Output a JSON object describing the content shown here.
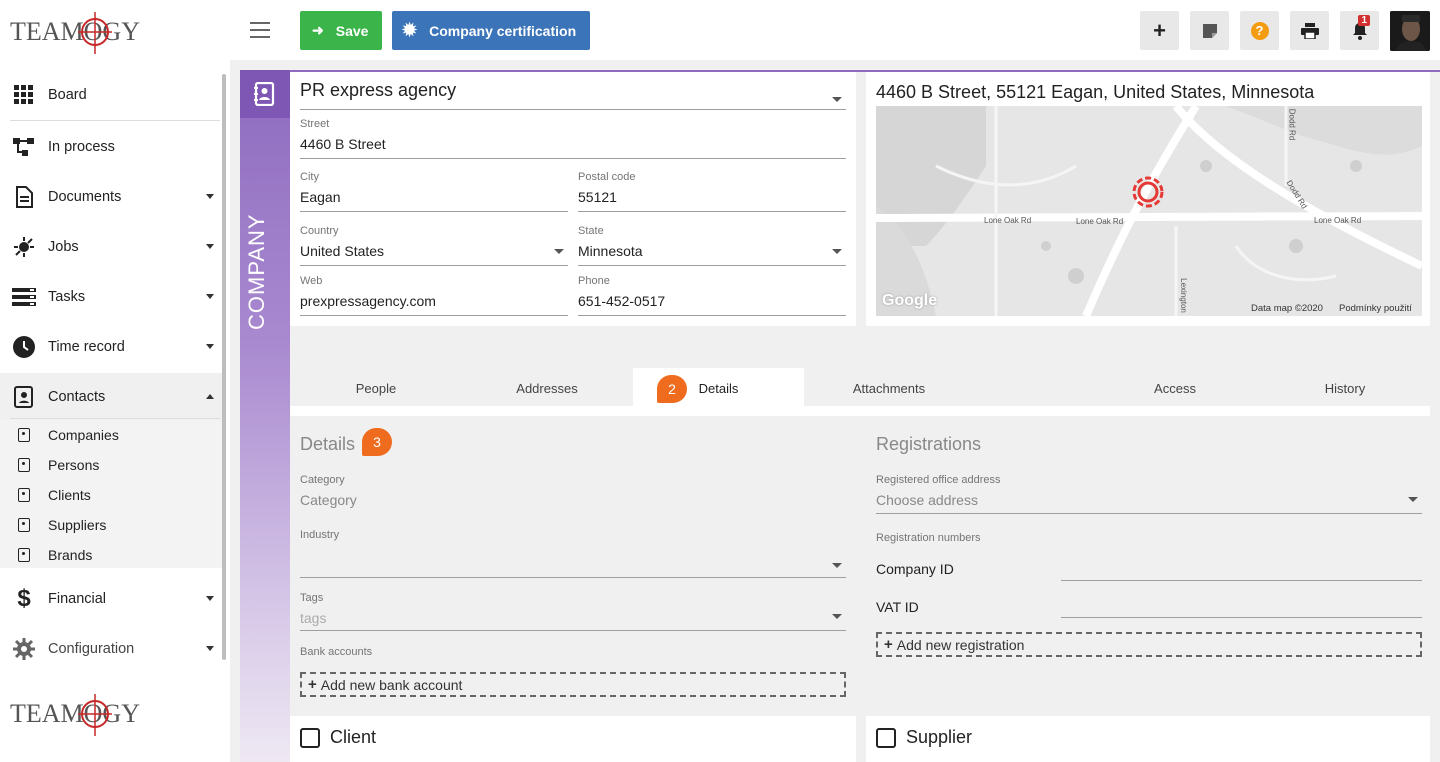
{
  "brand": {
    "logo_text": "TEAMOGY",
    "logo_bottom_text": "TEAMOGY"
  },
  "topbar": {
    "save_label": "Save",
    "cert_label": "Company certification",
    "notification_count": "1"
  },
  "sidebar": {
    "items": [
      {
        "label": "Board",
        "icon": "grid-icon"
      },
      {
        "label": "In process",
        "icon": "flow-icon"
      },
      {
        "label": "Documents",
        "icon": "document-icon"
      },
      {
        "label": "Jobs",
        "icon": "jobs-icon"
      },
      {
        "label": "Tasks",
        "icon": "tasks-icon"
      },
      {
        "label": "Time record",
        "icon": "clock-icon"
      },
      {
        "label": "Contacts",
        "icon": "contacts-icon"
      },
      {
        "label": "Financial",
        "icon": "dollar-icon"
      },
      {
        "label": "Configuration",
        "icon": "gear-icon"
      }
    ],
    "contacts_sub": [
      "Companies",
      "Persons",
      "Clients",
      "Suppliers",
      "Brands"
    ]
  },
  "company": {
    "strip_label": "COMPANY",
    "name": "PR express agency",
    "street_label": "Street",
    "street": "4460  B Street",
    "city_label": "City",
    "city": "Eagan",
    "postal_label": "Postal code",
    "postal": "55121",
    "country_label": "Country",
    "country": "United States",
    "state_label": "State",
    "state": "Minnesota",
    "web_label": "Web",
    "web": "prexpressagency.com",
    "phone_label": "Phone",
    "phone": "651-452-0517"
  },
  "map": {
    "title": "4460 B Street, 55121 Eagan, United States, Minnesota",
    "road1": "Lone Oak Rd",
    "road2": "Lone Oak Rd",
    "road3": "Lone Oak Rd",
    "road4": "Dodd Rd",
    "road5": "Dodd Rd",
    "road6": "Lexington",
    "google": "Google",
    "data_credit": "Data map ©2020",
    "terms": "Podmínky použití"
  },
  "tabs": [
    "People",
    "Addresses",
    "Details",
    "Attachments",
    "Access",
    "History"
  ],
  "badges": {
    "tab_badge": "2",
    "details_badge": "3"
  },
  "details": {
    "title": "Details",
    "category_label": "Category",
    "category_placeholder": "Category",
    "industry_label": "Industry",
    "industry_value": "",
    "tags_label": "Tags",
    "tags_placeholder": "tags",
    "bank_label": "Bank accounts",
    "add_bank": "Add new bank account"
  },
  "registrations": {
    "title": "Registrations",
    "office_label": "Registered office address",
    "office_placeholder": "Choose address",
    "numbers_label": "Registration numbers",
    "company_id_label": "Company ID",
    "vat_id_label": "VAT ID",
    "add_registration": "Add new registration"
  },
  "flags": {
    "client_label": "Client",
    "supplier_label": "Supplier"
  },
  "colors": {
    "save": "#3bb54a",
    "cert": "#3b74b8",
    "accent_purple": "#8e6bbf",
    "badge": "#ef6c1f"
  }
}
